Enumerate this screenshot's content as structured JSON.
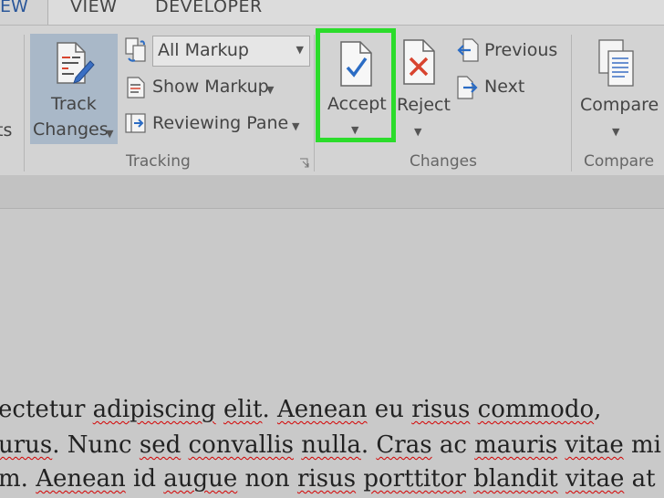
{
  "tabs": {
    "partial_left": "EW",
    "view": "VIEW",
    "developer": "DEVELOPER"
  },
  "ribbon": {
    "left_partial_label": "ts",
    "track_changes": {
      "line1": "Track",
      "line2": "Changes"
    },
    "markup_combo": {
      "value": "All Markup"
    },
    "show_markup": "Show Markup",
    "reviewing_pane": "Reviewing Pane",
    "tracking_group": "Tracking",
    "accept": "Accept",
    "reject": "Reject",
    "previous": "Previous",
    "next": "Next",
    "changes_group": "Changes",
    "compare": "Compare",
    "compare_group": "Compare"
  },
  "document": {
    "line1": {
      "segments": [
        {
          "text": "ectetur ",
          "squiggle": false
        },
        {
          "text": "adipiscing",
          "squiggle": true
        },
        {
          "text": " ",
          "squiggle": false
        },
        {
          "text": "elit",
          "squiggle": true
        },
        {
          "text": ". ",
          "squiggle": false
        },
        {
          "text": "Aenean",
          "squiggle": true
        },
        {
          "text": " eu ",
          "squiggle": false
        },
        {
          "text": "risus",
          "squiggle": true
        },
        {
          "text": " ",
          "squiggle": false
        },
        {
          "text": "commodo",
          "squiggle": true
        },
        {
          "text": ",",
          "squiggle": false
        }
      ]
    },
    "line2": {
      "segments": [
        {
          "text": "urus",
          "squiggle": true
        },
        {
          "text": ". ",
          "squiggle": false
        },
        {
          "text": "Nunc",
          "squiggle": false
        },
        {
          "text": " ",
          "squiggle": false
        },
        {
          "text": "sed",
          "squiggle": true
        },
        {
          "text": " ",
          "squiggle": false
        },
        {
          "text": "convallis",
          "squiggle": true
        },
        {
          "text": " ",
          "squiggle": false
        },
        {
          "text": "nulla",
          "squiggle": true
        },
        {
          "text": ". ",
          "squiggle": false
        },
        {
          "text": "Cras",
          "squiggle": true
        },
        {
          "text": " ac ",
          "squiggle": false
        },
        {
          "text": "mauris",
          "squiggle": true
        },
        {
          "text": " ",
          "squiggle": false
        },
        {
          "text": "vitae",
          "squiggle": true
        },
        {
          "text": " mi",
          "squiggle": false
        }
      ]
    },
    "line3": {
      "segments": [
        {
          "text": "m",
          "squiggle": false
        },
        {
          "text": ". ",
          "squiggle": false
        },
        {
          "text": "Aenean",
          "squiggle": true
        },
        {
          "text": " id ",
          "squiggle": false
        },
        {
          "text": "augue",
          "squiggle": true
        },
        {
          "text": " non ",
          "squiggle": false
        },
        {
          "text": "risus",
          "squiggle": true
        },
        {
          "text": " ",
          "squiggle": false
        },
        {
          "text": "porttitor",
          "squiggle": true
        },
        {
          "text": " ",
          "squiggle": false
        },
        {
          "text": "blandit",
          "squiggle": true
        },
        {
          "text": " ",
          "squiggle": false
        },
        {
          "text": "vitae",
          "squiggle": true
        },
        {
          "text": " at",
          "squiggle": false
        }
      ]
    }
  },
  "colors": {
    "highlight_box": "#2bdc2b",
    "ribbon_bg": "#d3d3d3",
    "active_button_bg": "#a9b8c8",
    "squiggle": "#d40000",
    "accept_check": "#2b6cc4",
    "reject_x": "#d8442f"
  }
}
